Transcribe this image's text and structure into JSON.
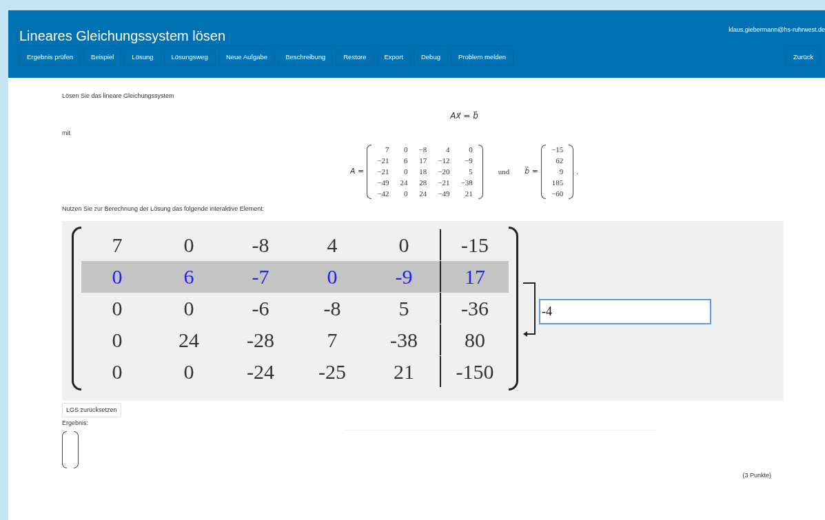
{
  "header": {
    "title": "Lineares Gleichungssystem lösen",
    "user": "klaus.giebermann@hs-ruhrwest.de",
    "nav": [
      "Ergebnis prüfen",
      "Beispiel",
      "Lösung",
      "Lösungsweg",
      "Neue Aufgabe",
      "Beschreibung",
      "Restore",
      "Export",
      "Debug",
      "Problem melden"
    ],
    "back": "Zurück"
  },
  "task": {
    "intro": "Lösen Sie das lineare Gleichungssystem",
    "equation": "Ax⃗ = b⃗",
    "with": "mit",
    "matrix_label": "A =",
    "matrix": [
      [
        "7",
        "0",
        "−8",
        "4",
        "0"
      ],
      [
        "−21",
        "6",
        "17",
        "−12",
        "−9"
      ],
      [
        "−21",
        "0",
        "18",
        "−20",
        "5"
      ],
      [
        "−49",
        "24",
        "28",
        "−21",
        "−38"
      ],
      [
        "−42",
        "0",
        "24",
        "−49",
        "21"
      ]
    ],
    "conjunction": "und",
    "vector_label": "b⃗ =",
    "vector": [
      "−15",
      "62",
      "9",
      "185",
      "−60"
    ],
    "end": ".",
    "instruction": "Nutzen Sie zur Berechnung der Lösung das folgende interaktive Element:"
  },
  "interactive": {
    "rows": [
      {
        "cells": [
          "7",
          "0",
          "-8",
          "4",
          "0"
        ],
        "rhs": "-15",
        "selected": false
      },
      {
        "cells": [
          "0",
          "6",
          "-7",
          "0",
          "-9"
        ],
        "rhs": "17",
        "selected": true
      },
      {
        "cells": [
          "0",
          "0",
          "-6",
          "-8",
          "5"
        ],
        "rhs": "-36",
        "selected": false
      },
      {
        "cells": [
          "0",
          "24",
          "-28",
          "7",
          "-38"
        ],
        "rhs": "80",
        "selected": false
      },
      {
        "cells": [
          "0",
          "0",
          "-24",
          "-25",
          "21"
        ],
        "rhs": "-150",
        "selected": false
      }
    ],
    "multiplier": "-4",
    "reset_button": "LGS zurücksetzen"
  },
  "result": {
    "label": "Ergebnis:"
  },
  "points": "(3 Punkte)"
}
